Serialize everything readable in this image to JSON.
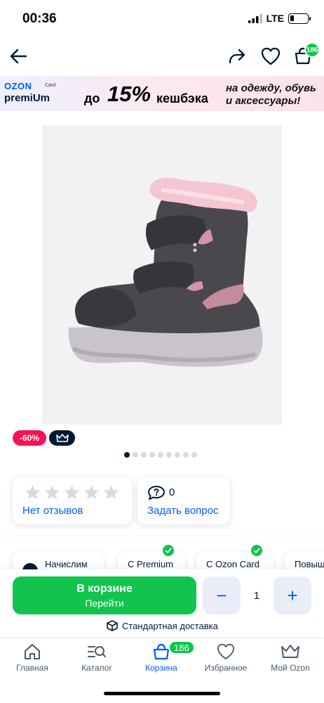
{
  "status_bar": {
    "time": "00:36",
    "network": "LTE",
    "icons": [
      "signal-icon",
      "battery-icon"
    ]
  },
  "top_nav": {
    "icons": [
      "back-arrow-icon",
      "share-icon",
      "heart-icon",
      "cart-icon"
    ],
    "cart_count": "186"
  },
  "banner": {
    "brand": "OZON",
    "card": "Card",
    "premium": "premiUm",
    "prefix": "до",
    "percent": "15%",
    "suffix": "кешбэка",
    "right_text": "на одежду, обувь и аксессуары!"
  },
  "product": {
    "image": "winter-boot-photo",
    "discount": "-60%",
    "premium_icon": "crown-icon"
  },
  "gallery": {
    "total": 9,
    "active": 0
  },
  "reviews": {
    "stars": 5,
    "link": "Нет отзывов"
  },
  "questions": {
    "count": "0",
    "link": "Задать вопрос"
  },
  "chips": [
    {
      "label": "Начислим",
      "checked": false
    },
    {
      "label": "С Premium",
      "checked": true
    },
    {
      "label": "С Ozon Card",
      "checked": true
    },
    {
      "label": "Повыш",
      "checked": false
    }
  ],
  "cart_panel": {
    "button_main": "В корзине",
    "button_sub": "Перейти",
    "minus": "−",
    "quantity": "1",
    "plus": "+",
    "delivery": "Стандартная доставка"
  },
  "tabs": [
    {
      "label": "Главная",
      "icon": "home-icon"
    },
    {
      "label": "Каталог",
      "icon": "catalog-icon"
    },
    {
      "label": "Корзина",
      "icon": "cart-icon",
      "badge": "186",
      "active": true
    },
    {
      "label": "Избранное",
      "icon": "heart-icon"
    },
    {
      "label": "Мой Ozon",
      "icon": "crown-icon"
    }
  ],
  "colors": {
    "accent": "#005bff",
    "green": "#10c44c",
    "sale": "#f91155",
    "text": "#001a34"
  }
}
